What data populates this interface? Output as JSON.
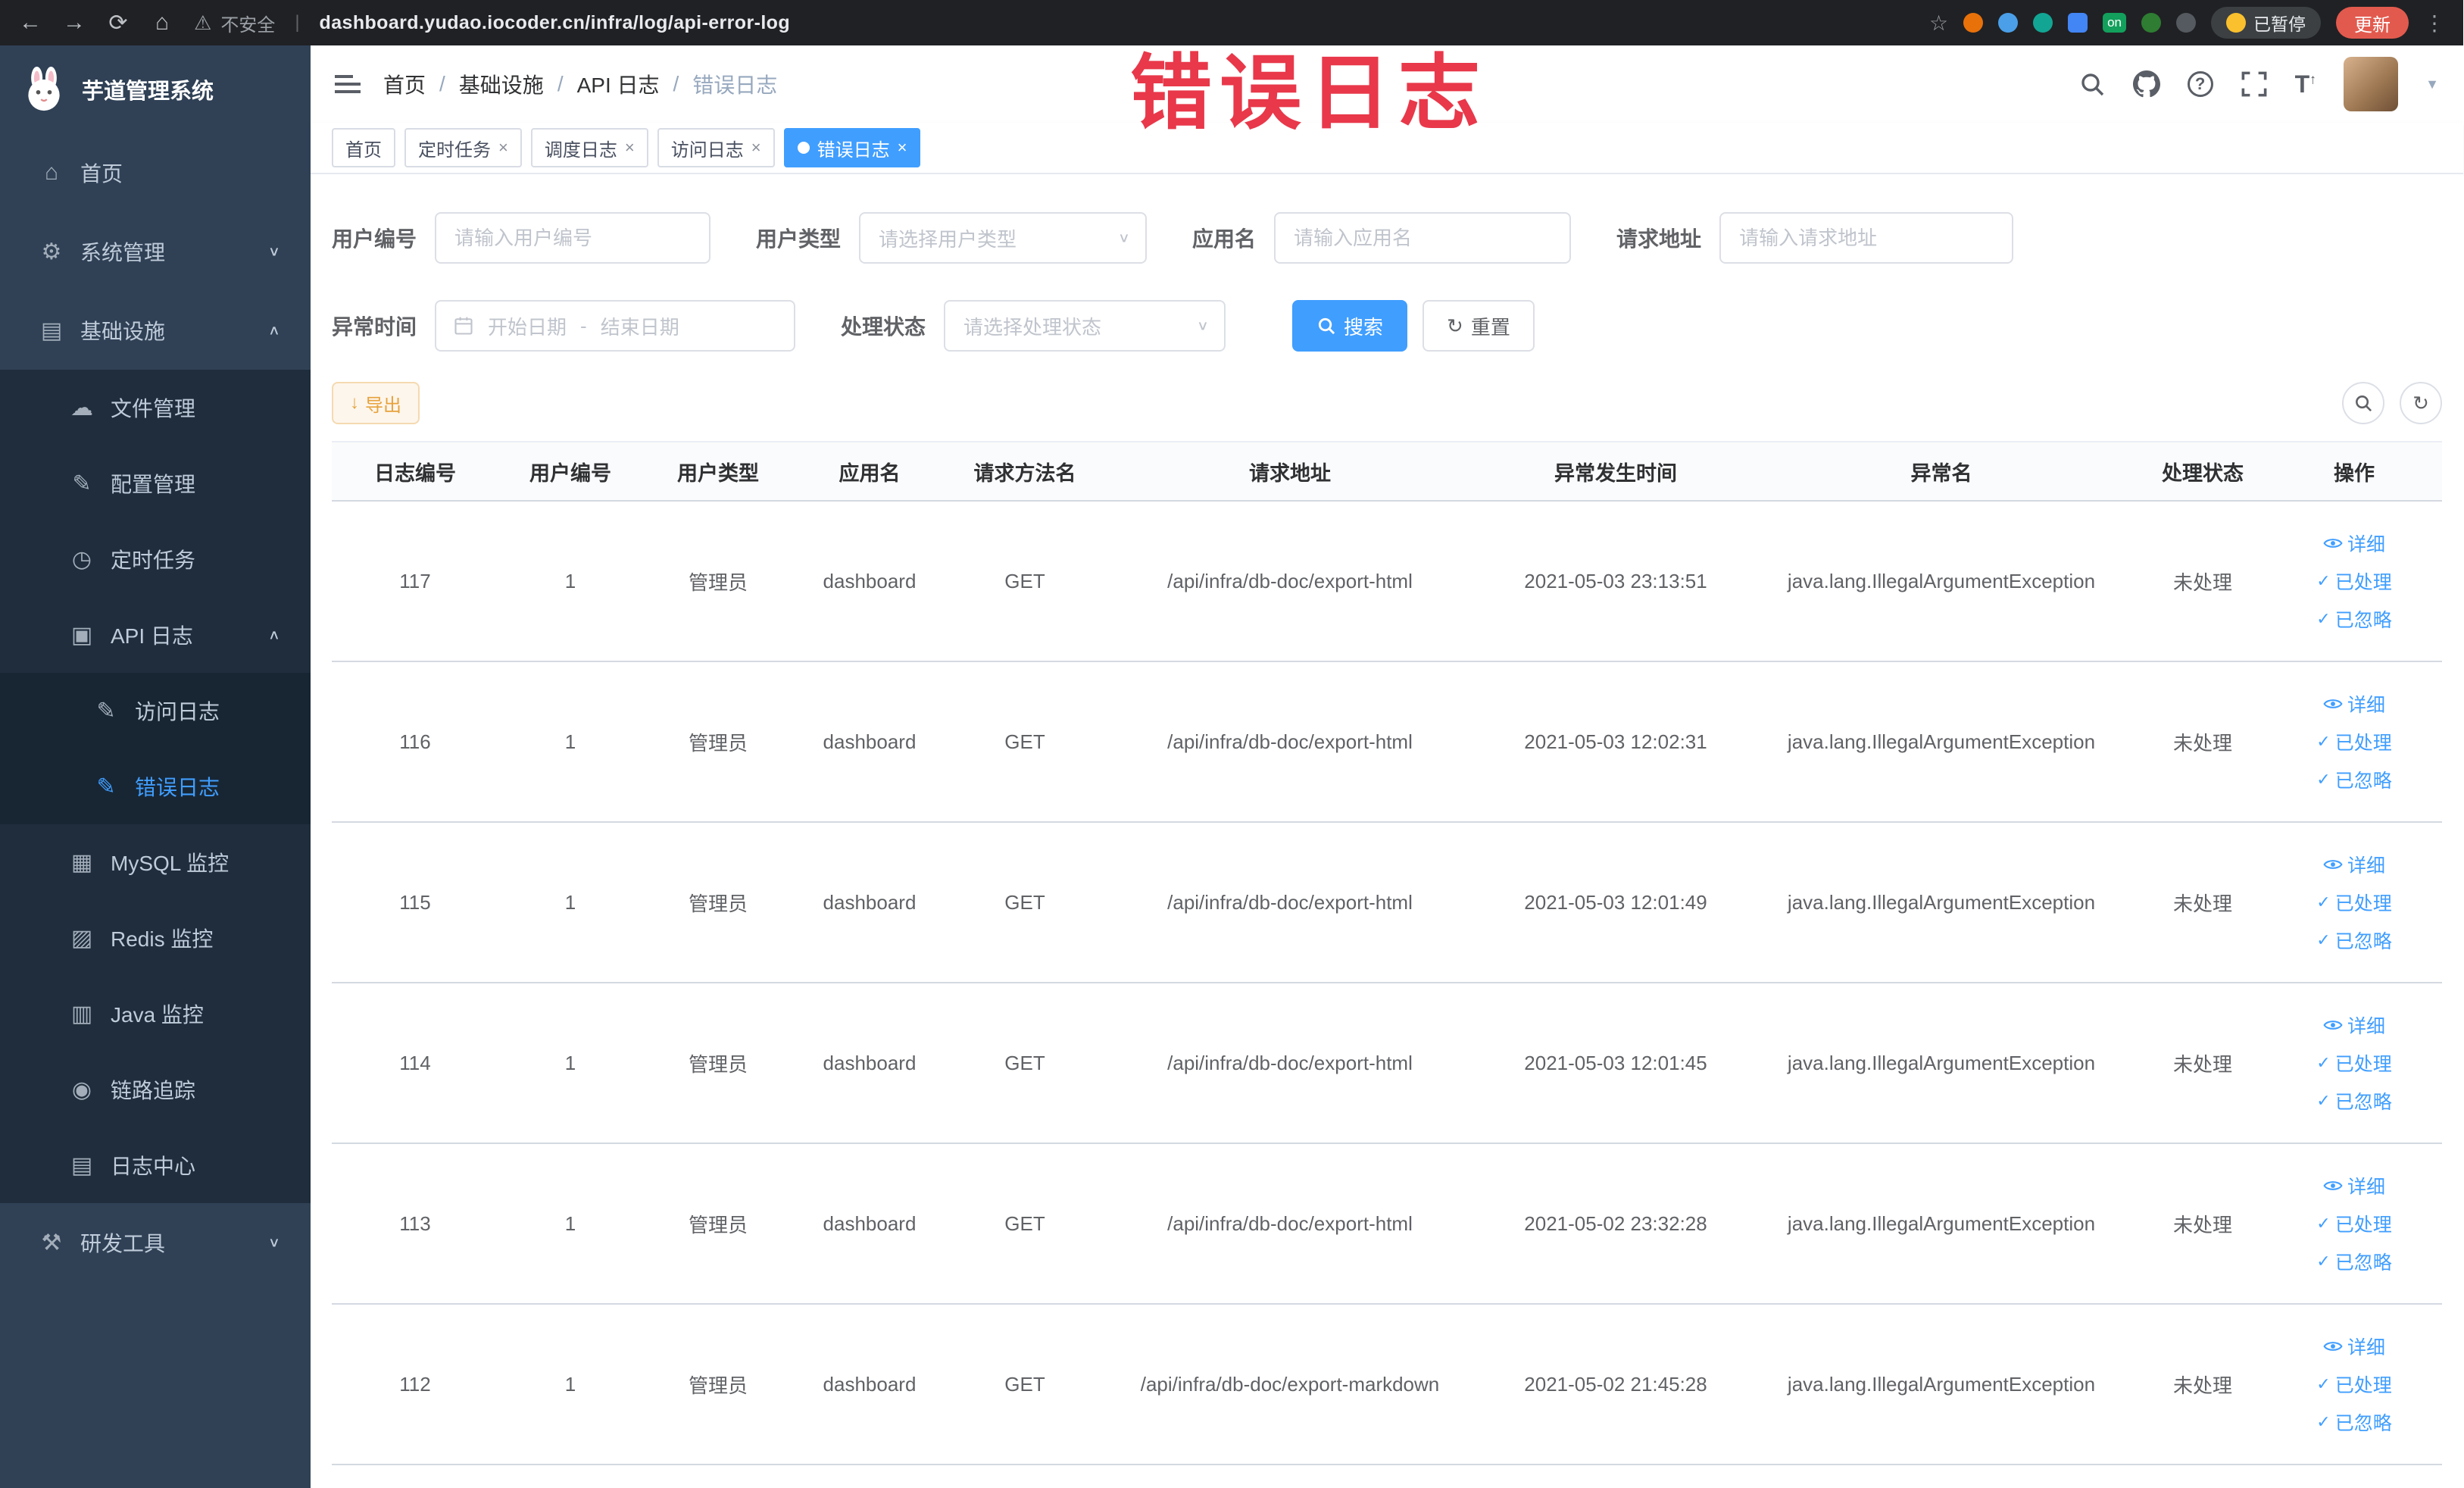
{
  "browser": {
    "security_label": "不安全",
    "url": "dashboard.yudao.iocoder.cn/infra/log/api-error-log",
    "extension_badge": "on",
    "paused_badge": "已暂停",
    "update_button": "更新"
  },
  "sidebar": {
    "logo_title": "芋道管理系统",
    "menu": {
      "home": "首页",
      "system": "系统管理",
      "infra": "基础设施",
      "file": "文件管理",
      "config": "配置管理",
      "job": "定时任务",
      "api_log": "API 日志",
      "access_log": "访问日志",
      "error_log": "错误日志",
      "mysql": "MySQL 监控",
      "redis": "Redis 监控",
      "java": "Java 监控",
      "trace": "链路追踪",
      "log_center": "日志中心",
      "dev_tools": "研发工具"
    }
  },
  "header": {
    "breadcrumb": [
      "首页",
      "基础设施",
      "API 日志",
      "错误日志"
    ]
  },
  "annotation": {
    "text": "错误日志"
  },
  "tabs": [
    {
      "label": "首页"
    },
    {
      "label": "定时任务"
    },
    {
      "label": "调度日志"
    },
    {
      "label": "访问日志"
    },
    {
      "label": "错误日志"
    }
  ],
  "filters": {
    "user_id_label": "用户编号",
    "user_id_placeholder": "请输入用户编号",
    "user_type_label": "用户类型",
    "user_type_placeholder": "请选择用户类型",
    "app_name_label": "应用名",
    "app_name_placeholder": "请输入应用名",
    "request_url_label": "请求地址",
    "request_url_placeholder": "请输入请求地址",
    "time_label": "异常时间",
    "time_start_placeholder": "开始日期",
    "time_separator": "-",
    "time_end_placeholder": "结束日期",
    "status_label": "处理状态",
    "status_placeholder": "请选择处理状态",
    "search_button": "搜索",
    "reset_button": "重置"
  },
  "toolbar": {
    "export_button": "导出"
  },
  "table": {
    "columns": [
      "日志编号",
      "用户编号",
      "用户类型",
      "应用名",
      "请求方法名",
      "请求地址",
      "异常发生时间",
      "异常名",
      "处理状态",
      "操作"
    ],
    "action_labels": {
      "detail": "详细",
      "processed": "已处理",
      "ignored": "已忽略"
    },
    "rows": [
      {
        "log_id": "117",
        "user_id": "1",
        "user_type": "管理员",
        "app_name": "dashboard",
        "method": "GET",
        "url": "/api/infra/db-doc/export-html",
        "time": "2021-05-03 23:13:51",
        "exception": "java.lang.IllegalArgumentException",
        "status": "未处理"
      },
      {
        "log_id": "116",
        "user_id": "1",
        "user_type": "管理员",
        "app_name": "dashboard",
        "method": "GET",
        "url": "/api/infra/db-doc/export-html",
        "time": "2021-05-03 12:02:31",
        "exception": "java.lang.IllegalArgumentException",
        "status": "未处理"
      },
      {
        "log_id": "115",
        "user_id": "1",
        "user_type": "管理员",
        "app_name": "dashboard",
        "method": "GET",
        "url": "/api/infra/db-doc/export-html",
        "time": "2021-05-03 12:01:49",
        "exception": "java.lang.IllegalArgumentException",
        "status": "未处理"
      },
      {
        "log_id": "114",
        "user_id": "1",
        "user_type": "管理员",
        "app_name": "dashboard",
        "method": "GET",
        "url": "/api/infra/db-doc/export-html",
        "time": "2021-05-03 12:01:45",
        "exception": "java.lang.IllegalArgumentException",
        "status": "未处理"
      },
      {
        "log_id": "113",
        "user_id": "1",
        "user_type": "管理员",
        "app_name": "dashboard",
        "method": "GET",
        "url": "/api/infra/db-doc/export-html",
        "time": "2021-05-02 23:32:28",
        "exception": "java.lang.IllegalArgumentException",
        "status": "未处理"
      },
      {
        "log_id": "112",
        "user_id": "1",
        "user_type": "管理员",
        "app_name": "dashboard",
        "method": "GET",
        "url": "/api/infra/db-doc/export-markdown",
        "time": "2021-05-02 21:45:28",
        "exception": "java.lang.IllegalArgumentException",
        "status": "未处理"
      }
    ]
  }
}
